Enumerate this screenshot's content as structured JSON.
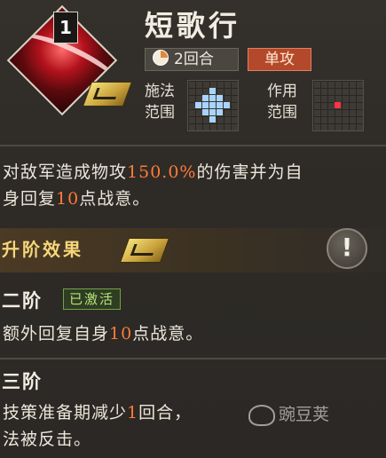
{
  "skill": {
    "level": "1",
    "name": "短歌行",
    "rounds_label": "2回合",
    "attack_type": "单攻",
    "cast_range_label_1": "施法",
    "cast_range_label_2": "范围",
    "effect_range_label_1": "作用",
    "effect_range_label_2": "范围",
    "description_parts": [
      "对敌军造成物攻",
      "150.0%",
      "的伤害并为自",
      "身回复",
      "10",
      "点战意。"
    ]
  },
  "upgrade": {
    "title": "升阶效果",
    "info_symbol": "!",
    "tier2": {
      "title": "二阶",
      "status": "已激活",
      "desc_parts": [
        "额外回复自身",
        "10",
        "点战意。"
      ]
    },
    "tier3": {
      "title": "三阶",
      "desc_parts": [
        "技策准备期减少",
        "1",
        "回合，",
        "法被反击。"
      ]
    }
  },
  "watermark": {
    "text": "豌豆荚"
  },
  "colors": {
    "highlight": "#ff7a3a",
    "gold": "#f6d77a",
    "single_attack": "#b4482a",
    "activated": "#b6e07c"
  },
  "icons": [
    "skill-icon",
    "rank-badge-icon",
    "clock-icon",
    "info-icon",
    "watermark-logo-icon"
  ]
}
